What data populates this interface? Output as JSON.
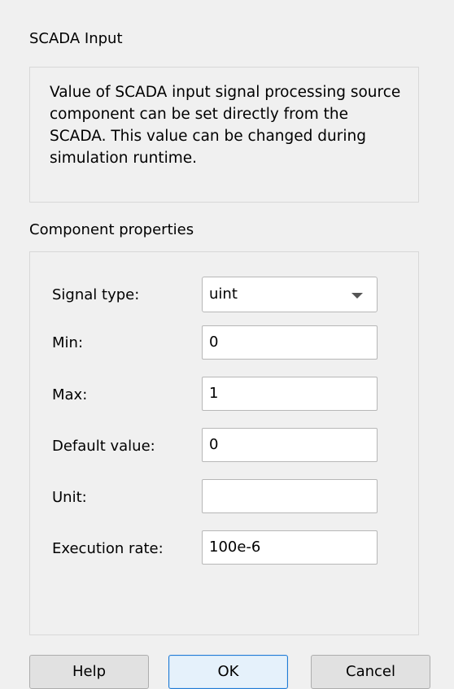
{
  "scada_input": {
    "title": "SCADA Input",
    "description": "Value of SCADA input signal processing source component can be set directly from the SCADA. This value can be changed during simulation runtime."
  },
  "component_properties": {
    "title": "Component properties",
    "signal_type": {
      "label": "Signal type:",
      "value": "uint"
    },
    "min": {
      "label": "Min:",
      "value": "0"
    },
    "max": {
      "label": "Max:",
      "value": "1"
    },
    "default_value": {
      "label": "Default value:",
      "value": "0"
    },
    "unit": {
      "label": "Unit:",
      "value": ""
    },
    "execution_rate": {
      "label": "Execution rate:",
      "value": "100e-6"
    }
  },
  "buttons": {
    "help": "Help",
    "ok": "OK",
    "cancel": "Cancel"
  },
  "icons": {
    "dropdown": "chevron-down-icon"
  },
  "colors": {
    "background": "#f0f0f0",
    "ok_border": "#1e7bd6"
  }
}
